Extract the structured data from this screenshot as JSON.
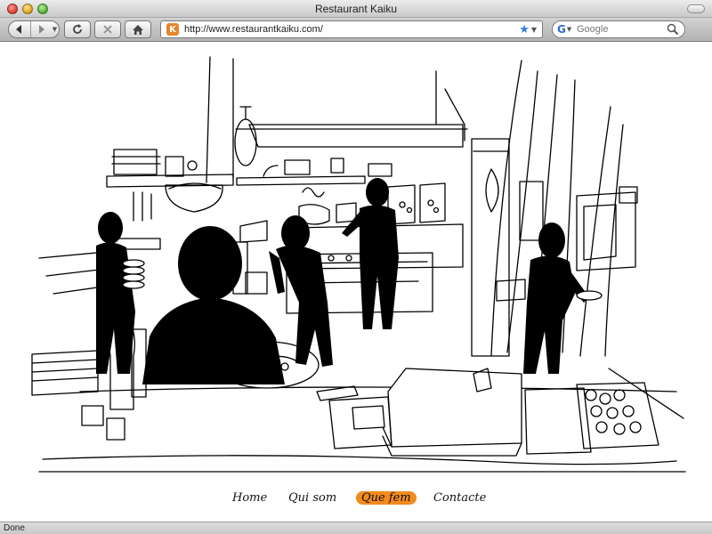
{
  "window": {
    "title": "Restaurant Kaiku"
  },
  "toolbar": {
    "url": "http://www.restaurantkaiku.com/",
    "favicon_letter": "K",
    "search_placeholder": "Google",
    "search_engine_letter": "G",
    "icons": [
      "back-arrow-icon",
      "forward-arrow-icon",
      "reload-icon",
      "stop-icon",
      "home-icon",
      "star-icon",
      "magnifier-icon"
    ]
  },
  "nav": {
    "items": [
      {
        "label": "Home",
        "active": false
      },
      {
        "label": "Qui som",
        "active": false
      },
      {
        "label": "Que fem",
        "active": true
      },
      {
        "label": "Contacte",
        "active": false
      }
    ]
  },
  "status": {
    "text": "Done"
  },
  "colors": {
    "accent": "#f28a1c",
    "favicon": "#e8862a"
  }
}
